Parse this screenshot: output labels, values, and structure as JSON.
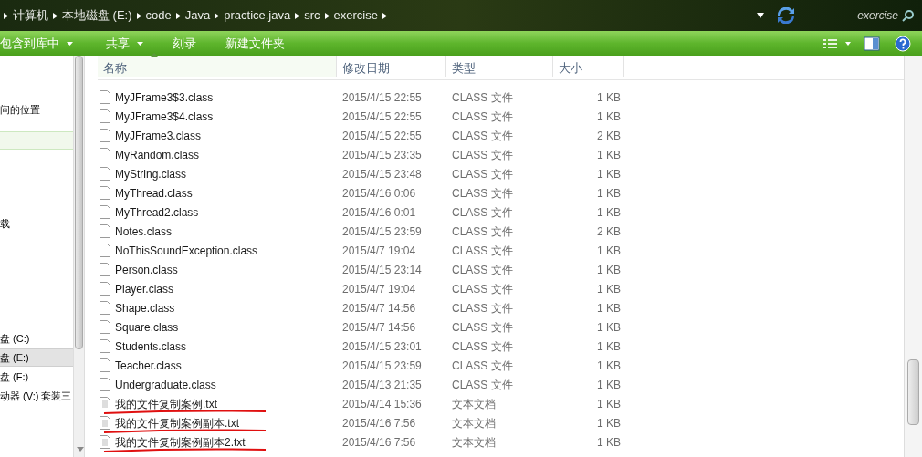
{
  "breadcrumb": [
    "计算机",
    "本地磁盘 (E:)",
    "code",
    "Java",
    "practice.java",
    "src",
    "exercise"
  ],
  "search": {
    "placeholder": "exercise"
  },
  "toolbar": [
    "包含到库中",
    "共享",
    "刻录",
    "新建文件夹"
  ],
  "nav": [
    {
      "label": "问的位置",
      "selected": false
    },
    {
      "selected": true
    },
    {
      "label": "载",
      "selected": false
    },
    {
      "label": "盘 (C:)",
      "selected": false
    },
    {
      "label": "盘 (E:)",
      "selected": true
    },
    {
      "label": "盘 (F:)",
      "selected": false
    },
    {
      "label": "动器 (V:) 套装三",
      "selected": false
    }
  ],
  "columns": [
    {
      "label": "名称",
      "sorted": true
    },
    {
      "label": "修改日期",
      "sorted": false
    },
    {
      "label": "类型",
      "sorted": false
    },
    {
      "label": "大小",
      "sorted": false
    }
  ],
  "files": [
    {
      "name": "MyJFrame3$3.class",
      "date": "2015/4/15 22:55",
      "type": "CLASS 文件",
      "size": "1 KB",
      "underlined": false
    },
    {
      "name": "MyJFrame3$4.class",
      "date": "2015/4/15 22:55",
      "type": "CLASS 文件",
      "size": "1 KB",
      "underlined": false
    },
    {
      "name": "MyJFrame3.class",
      "date": "2015/4/15 22:55",
      "type": "CLASS 文件",
      "size": "2 KB",
      "underlined": false
    },
    {
      "name": "MyRandom.class",
      "date": "2015/4/15 23:35",
      "type": "CLASS 文件",
      "size": "1 KB",
      "underlined": false
    },
    {
      "name": "MyString.class",
      "date": "2015/4/15 23:48",
      "type": "CLASS 文件",
      "size": "1 KB",
      "underlined": false
    },
    {
      "name": "MyThread.class",
      "date": "2015/4/16 0:06",
      "type": "CLASS 文件",
      "size": "1 KB",
      "underlined": false
    },
    {
      "name": "MyThread2.class",
      "date": "2015/4/16 0:01",
      "type": "CLASS 文件",
      "size": "1 KB",
      "underlined": false
    },
    {
      "name": "Notes.class",
      "date": "2015/4/15 23:59",
      "type": "CLASS 文件",
      "size": "2 KB",
      "underlined": false
    },
    {
      "name": "NoThisSoundException.class",
      "date": "2015/4/7 19:04",
      "type": "CLASS 文件",
      "size": "1 KB",
      "underlined": false
    },
    {
      "name": "Person.class",
      "date": "2015/4/15 23:14",
      "type": "CLASS 文件",
      "size": "1 KB",
      "underlined": false
    },
    {
      "name": "Player.class",
      "date": "2015/4/7 19:04",
      "type": "CLASS 文件",
      "size": "1 KB",
      "underlined": false
    },
    {
      "name": "Shape.class",
      "date": "2015/4/7 14:56",
      "type": "CLASS 文件",
      "size": "1 KB",
      "underlined": false
    },
    {
      "name": "Square.class",
      "date": "2015/4/7 14:56",
      "type": "CLASS 文件",
      "size": "1 KB",
      "underlined": false
    },
    {
      "name": "Students.class",
      "date": "2015/4/15 23:01",
      "type": "CLASS 文件",
      "size": "1 KB",
      "underlined": false
    },
    {
      "name": "Teacher.class",
      "date": "2015/4/15 23:59",
      "type": "CLASS 文件",
      "size": "1 KB",
      "underlined": false
    },
    {
      "name": "Undergraduate.class",
      "date": "2015/4/13 21:35",
      "type": "CLASS 文件",
      "size": "1 KB",
      "underlined": false
    },
    {
      "name": "我的文件复制案例.txt",
      "date": "2015/4/14 15:36",
      "type": "文本文档",
      "size": "1 KB",
      "underlined": true
    },
    {
      "name": "我的文件复制案例副本.txt",
      "date": "2015/4/16 7:56",
      "type": "文本文档",
      "size": "1 KB",
      "underlined": true
    },
    {
      "name": "我的文件复制案例副本2.txt",
      "date": "2015/4/16 7:56",
      "type": "文本文档",
      "size": "1 KB",
      "underlined": true
    }
  ]
}
